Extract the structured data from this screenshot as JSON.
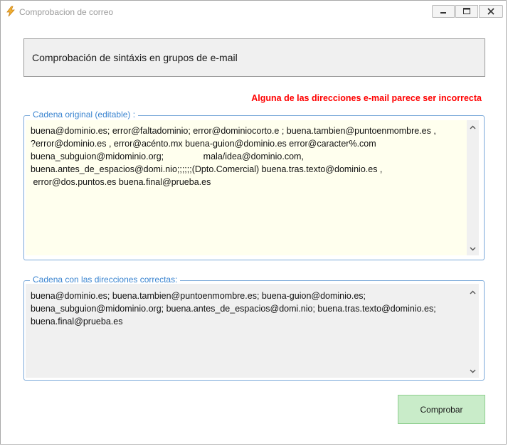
{
  "window": {
    "title": "Comprobacion de correo",
    "icon": "lightning-bolt-icon"
  },
  "header": {
    "title": "Comprobación de sintáxis en grupos de e-mail"
  },
  "error_message": "Alguna de las direcciones e-mail parece ser incorrecta",
  "original": {
    "label": "Cadena original (editable) :",
    "value": "buena@dominio.es; error@faltadominio; error@dominiocorto.e ; buena.tambien@puntoenmombre.es ,\n?error@dominio.es , error@acénto.mx buena-guion@dominio.es error@caracter%.com\nbuena_subguion@midominio.org;                mala/idea@dominio.com,\nbuena.antes_de_espacios@domi.nio;;;;;;(Dpto.Comercial) buena.tras.texto@dominio.es ,\n error@dos.puntos.es buena.final@prueba.es"
  },
  "correct": {
    "label": "Cadena con las direcciones correctas:",
    "value": "buena@dominio.es; buena.tambien@puntoenmombre.es; buena-guion@dominio.es;\nbuena_subguion@midominio.org; buena.antes_de_espacios@domi.nio; buena.tras.texto@dominio.es;\nbuena.final@prueba.es"
  },
  "button": {
    "label": "Comprobar"
  },
  "colors": {
    "error": "#ff0000",
    "group_border": "#7aa9d9",
    "group_label": "#3a84d0",
    "editable_bg": "#ffffee",
    "button_bg": "#c9ecc9"
  }
}
